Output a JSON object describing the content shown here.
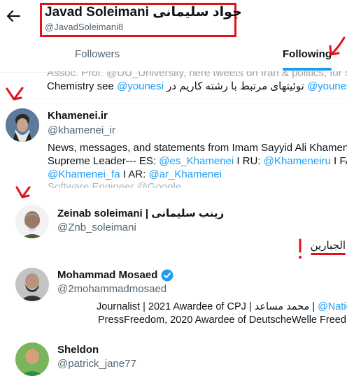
{
  "header": {
    "back_label": "←",
    "title": "Javad Soleimani جواد سلیمانی",
    "handle": "@JavadSoleimani8"
  },
  "tabs": [
    {
      "label": "Followers",
      "selected": false
    },
    {
      "label": "Following",
      "selected": true
    }
  ],
  "partial_top": {
    "line1": "Assoc. Prof. @UU_University, here tweets on Iran & politics, for S",
    "line2_prefix": "Chemistry see ",
    "line2_link": "@younesi",
    "line2_persian": "توئیتهای مرتبط با رشته کاریم در",
    "line2_link2": "@younesi"
  },
  "users": [
    {
      "name": "Khamenei.ir",
      "handle": "@khamenei_ir",
      "bio_line1": "News, messages, and statements from Imam Sayyid Ali Khamene",
      "bio_line2_a": "Supreme Leader--- ES: ",
      "bio_line2_l1": "@es_Khamenei",
      "bio_line2_b": " I RU: ",
      "bio_line2_l2": "@Khameneiru",
      "bio_line2_c": " I FA:",
      "bio_line3_l1": "@Khamenei_fa",
      "bio_line3_a": " I AR: ",
      "bio_line3_l2": "@ar_Khamenei",
      "bio_line4": "Software Engineer @Google"
    },
    {
      "name": "Zeinab soleimani | زینب سلیمانی",
      "handle": "@Znb_soleimani",
      "bio": "الجبارین"
    },
    {
      "name": "Mohammad Mosaed",
      "handle": "@2mohammadmosaed",
      "bio_line1_text": "Journalist | 2021 Awardee of CPJ | محمد مساعد | ",
      "bio_line1_link": "@Natio",
      "bio_line2": "PressFreedom, 2020 Awardee of DeutscheWelle Freed"
    },
    {
      "name": "Sheldon",
      "handle": "@patrick_jane77"
    }
  ],
  "annotation_color": "#e2111b",
  "accent_color": "#1d9bf0"
}
